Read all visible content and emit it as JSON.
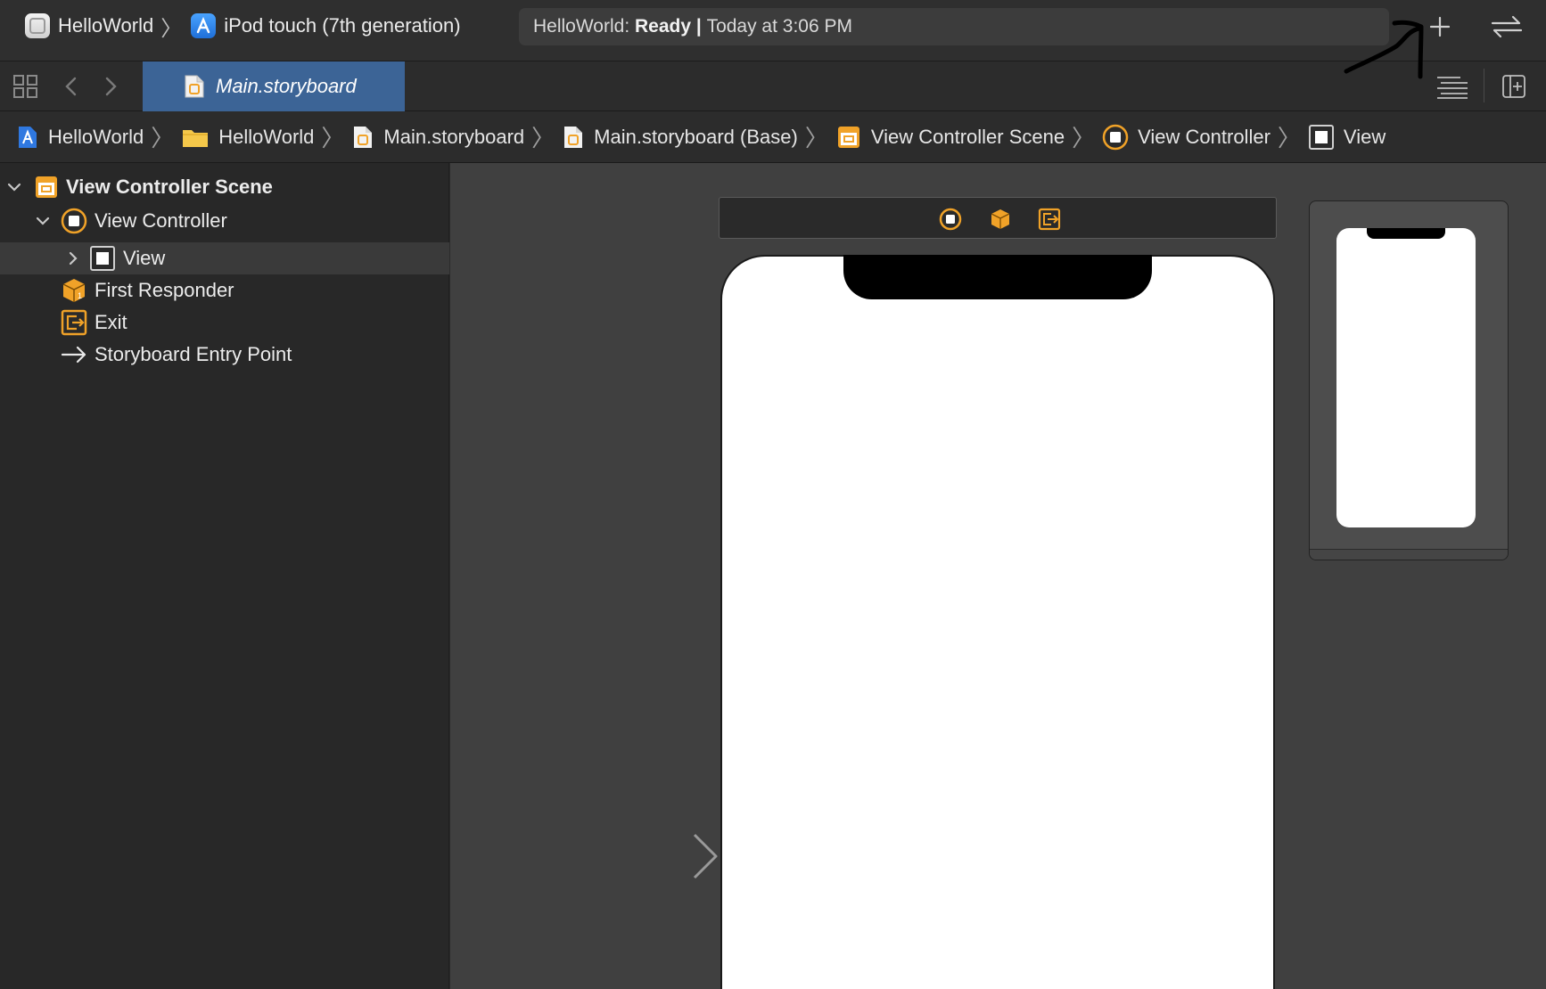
{
  "toolbar": {
    "scheme": "HelloWorld",
    "destination": "iPod touch (7th generation)",
    "status_prefix": "HelloWorld: ",
    "status_state": "Ready",
    "status_sep": " | ",
    "status_time": "Today at 3:06 PM",
    "add_icon": "plus-icon",
    "swap_icon": "swap-arrows-icon"
  },
  "tabs": [
    {
      "label": "Main.storyboard",
      "icon": "storyboard-file-icon"
    }
  ],
  "jumpbar": {
    "crumbs": [
      {
        "label": "HelloWorld",
        "icon": "project-icon"
      },
      {
        "label": "HelloWorld",
        "icon": "folder-icon"
      },
      {
        "label": "Main.storyboard",
        "icon": "storyboard-file-icon"
      },
      {
        "label": "Main.storyboard (Base)",
        "icon": "storyboard-file-icon"
      },
      {
        "label": "View Controller Scene",
        "icon": "scene-icon"
      },
      {
        "label": "View Controller",
        "icon": "view-controller-icon"
      },
      {
        "label": "View",
        "icon": "view-icon"
      }
    ]
  },
  "outline": {
    "items": [
      {
        "label": "View Controller Scene",
        "icon": "scene-icon",
        "expanded": true
      },
      {
        "label": "View Controller",
        "icon": "view-controller-icon",
        "expanded": true
      },
      {
        "label": "View",
        "icon": "view-icon",
        "expanded": false,
        "selected": true
      },
      {
        "label": "First Responder",
        "icon": "first-responder-icon"
      },
      {
        "label": "Exit",
        "icon": "exit-icon"
      },
      {
        "label": "Storyboard Entry Point",
        "icon": "entry-point-arrow-icon"
      }
    ]
  },
  "colors": {
    "selected_tab": "#3c6496",
    "accent_orange": "#f0a228",
    "canvas": "#404040"
  }
}
